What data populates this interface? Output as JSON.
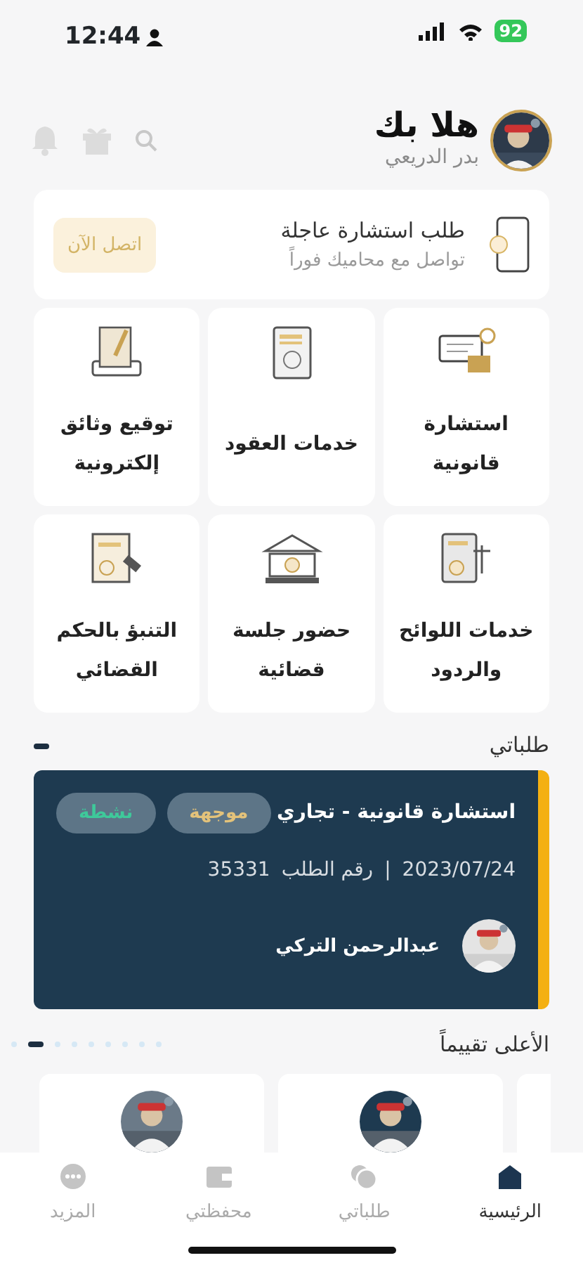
{
  "status_bar": {
    "time": "12:44",
    "battery": "92"
  },
  "header": {
    "greeting": "هلا بك",
    "user_name": "بدر الدريعي"
  },
  "urgent": {
    "title": "طلب استشارة عاجلة",
    "subtitle": "تواصل مع محاميك فوراً",
    "button": "اتصل الآن"
  },
  "services": [
    {
      "kind": "chat",
      "label": "استشارة\nقانونية"
    },
    {
      "kind": "contract",
      "label": "خدمات العقود"
    },
    {
      "kind": "sign",
      "label": "توقيع وثائق\nإلكترونية"
    },
    {
      "kind": "scales",
      "label": "خدمات اللوائح\nوالردود"
    },
    {
      "kind": "court",
      "label": "حضور جلسة\nقضائية"
    },
    {
      "kind": "gavel",
      "label": "التنبؤ بالحكم\nالقضائي"
    }
  ],
  "my_requests": {
    "title": "طلباتي",
    "pager": [
      {
        "selected": true
      }
    ],
    "request": {
      "title": "استشارة قانونية - تجاري",
      "tags": [
        {
          "label": "موجهة",
          "kind": "directed"
        },
        {
          "label": "نشطة",
          "kind": "active"
        }
      ],
      "date": "2023/07/24",
      "separator": "|",
      "number_label": "رقم الطلب",
      "number": "35331",
      "lawyer": "عبدالرحمن التركي"
    }
  },
  "top_rated": {
    "title": "الأعلى تقييماً",
    "pager": [
      {
        "selected": false
      },
      {
        "selected": true
      },
      {
        "selected": false
      },
      {
        "selected": false
      },
      {
        "selected": false
      },
      {
        "selected": false
      },
      {
        "selected": false
      },
      {
        "selected": false
      },
      {
        "selected": false
      }
    ],
    "cards": [
      {
        "kind": "edge"
      },
      {
        "kind": "picture"
      },
      {
        "kind": "picture"
      }
    ]
  },
  "bottom_nav": [
    {
      "kind": "home",
      "label": "الرئيسية",
      "selected": true
    },
    {
      "kind": "chats",
      "label": "طلباتي",
      "selected": false
    },
    {
      "kind": "wallet",
      "label": "محفظتي",
      "selected": false
    },
    {
      "kind": "more",
      "label": "المزيد",
      "selected": false
    }
  ]
}
